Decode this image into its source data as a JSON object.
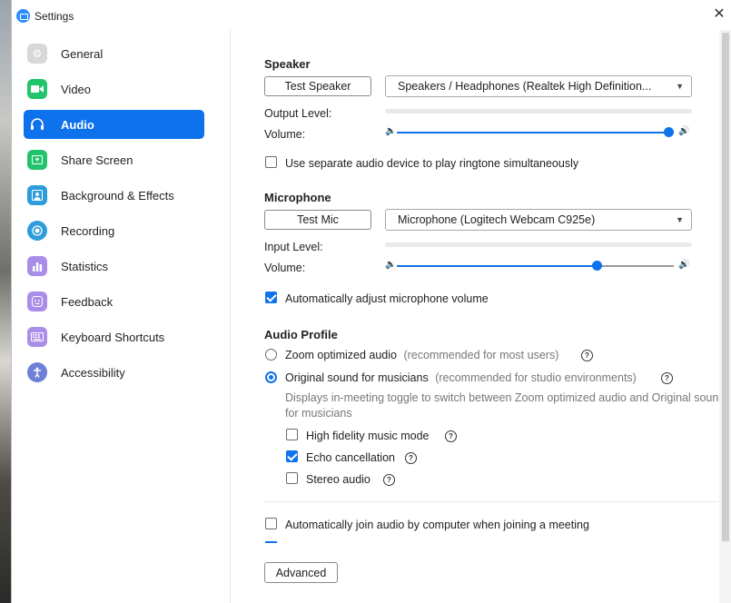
{
  "window": {
    "title": "Settings"
  },
  "sidebar": {
    "items": [
      {
        "label": "General",
        "icon": "gear-icon",
        "color": "#d8d8d8",
        "active": false
      },
      {
        "label": "Video",
        "icon": "video-camera-icon",
        "color": "#21c36b",
        "active": false
      },
      {
        "label": "Audio",
        "icon": "headphones-icon",
        "color": "#0e72ed",
        "active": true
      },
      {
        "label": "Share Screen",
        "icon": "share-screen-icon",
        "color": "#21c36b",
        "active": false
      },
      {
        "label": "Background & Effects",
        "icon": "person-background-icon",
        "color": "#2d9cdb",
        "active": false
      },
      {
        "label": "Recording",
        "icon": "record-icon",
        "color": "#2d9cdb",
        "active": false
      },
      {
        "label": "Statistics",
        "icon": "bar-chart-icon",
        "color": "#a98de8",
        "active": false
      },
      {
        "label": "Feedback",
        "icon": "smiley-icon",
        "color": "#a98de8",
        "active": false
      },
      {
        "label": "Keyboard Shortcuts",
        "icon": "keyboard-icon",
        "color": "#a98de8",
        "active": false
      },
      {
        "label": "Accessibility",
        "icon": "accessibility-icon",
        "color": "#6e7fd8",
        "active": false
      }
    ]
  },
  "speaker": {
    "title": "Speaker",
    "test_label": "Test Speaker",
    "device": "Speakers / Headphones (Realtek High Definition...",
    "output_level_label": "Output Level:",
    "volume_label": "Volume:",
    "volume": 0.98,
    "ringtone_label": "Use separate audio device to play ringtone simultaneously",
    "ringtone_checked": false
  },
  "microphone": {
    "title": "Microphone",
    "test_label": "Test Mic",
    "device": "Microphone (Logitech Webcam C925e)",
    "input_level_label": "Input Level:",
    "volume_label": "Volume:",
    "volume": 0.72,
    "auto_adjust_label": "Automatically adjust microphone volume",
    "auto_adjust_checked": true
  },
  "audio_profile": {
    "title": "Audio Profile",
    "zoom_optimized": {
      "label": "Zoom optimized audio",
      "hint": "(recommended for most users)",
      "selected": false
    },
    "original_sound": {
      "label": "Original sound for musicians",
      "hint": "(recommended for studio environments)",
      "selected": true,
      "desc": "Displays in-meeting toggle to switch between Zoom optimized audio and Original sound for musicians"
    },
    "options": [
      {
        "label": "High fidelity music mode",
        "checked": false
      },
      {
        "label": "Echo cancellation",
        "checked": true
      },
      {
        "label": "Stereo audio",
        "checked": false
      }
    ]
  },
  "auto_join": {
    "label": "Automatically join audio by computer when joining a meeting",
    "checked": false
  },
  "advanced_label": "Advanced",
  "colors": {
    "accent": "#0e72ed"
  }
}
